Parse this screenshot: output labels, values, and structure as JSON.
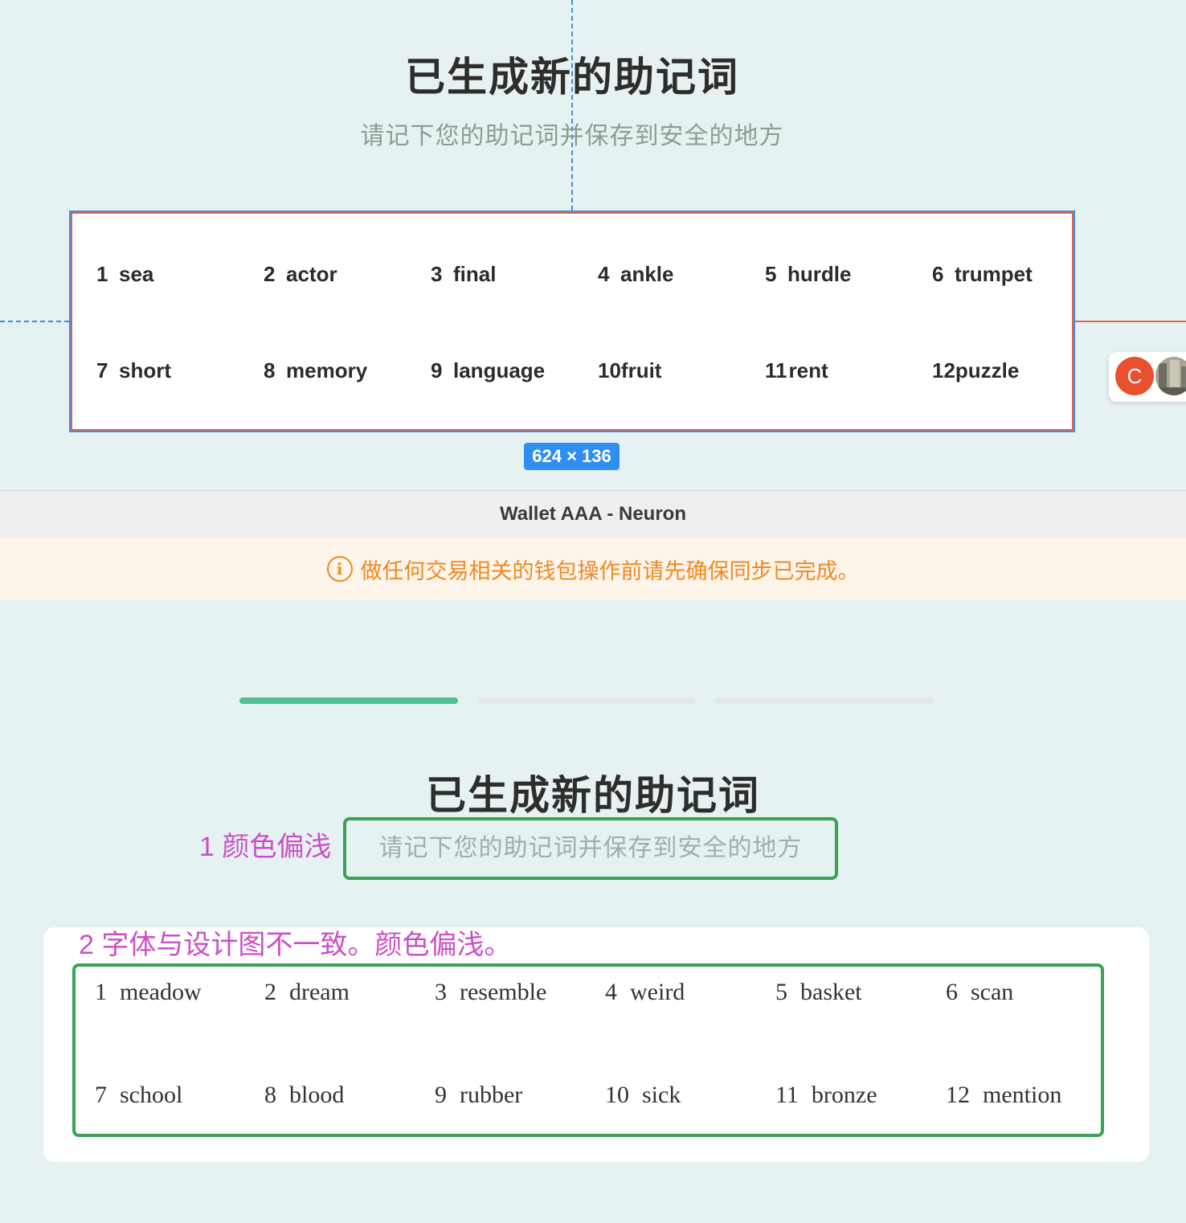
{
  "design": {
    "title": "已生成新的助记词",
    "subtitle": "请记下您的助记词并保存到安全的地方",
    "words": [
      {
        "num": "1",
        "word": "sea"
      },
      {
        "num": "2",
        "word": "actor"
      },
      {
        "num": "3",
        "word": "final"
      },
      {
        "num": "4",
        "word": "ankle"
      },
      {
        "num": "5",
        "word": "hurdle"
      },
      {
        "num": "6",
        "word": "trumpet"
      },
      {
        "num": "7",
        "word": "short"
      },
      {
        "num": "8",
        "word": "memory"
      },
      {
        "num": "9",
        "word": "language"
      },
      {
        "num": "10",
        "word": "fruit"
      },
      {
        "num": "11",
        "word": "rent"
      },
      {
        "num": "12",
        "word": "puzzle"
      }
    ],
    "size_badge": "624 × 136",
    "avatar_letter": "C"
  },
  "app": {
    "window_title": "Wallet AAA - Neuron",
    "warning": "做任何交易相关的钱包操作前请先确保同步已完成。",
    "warning_icon": "info-icon",
    "steps": [
      {
        "state": "active"
      },
      {
        "state": "inactive"
      },
      {
        "state": "inactive"
      }
    ],
    "title": "已生成新的助记词",
    "subtitle": "请记下您的助记词并保存到安全的地方",
    "words": [
      {
        "num": "1",
        "word": "meadow"
      },
      {
        "num": "2",
        "word": "dream"
      },
      {
        "num": "3",
        "word": "resemble"
      },
      {
        "num": "4",
        "word": "weird"
      },
      {
        "num": "5",
        "word": "basket"
      },
      {
        "num": "6",
        "word": "scan"
      },
      {
        "num": "7",
        "word": "school"
      },
      {
        "num": "8",
        "word": "blood"
      },
      {
        "num": "9",
        "word": "rubber"
      },
      {
        "num": "10",
        "word": "sick"
      },
      {
        "num": "11",
        "word": "bronze"
      },
      {
        "num": "12",
        "word": "mention"
      }
    ]
  },
  "annotations": {
    "note1": "1 颜色偏浅",
    "note2": "2 字体与设计图不一致。颜色偏浅。"
  },
  "colors": {
    "background": "#e6f2f1",
    "step_active": "#4dc193",
    "warning": "#f08a24",
    "annotation_text": "#cc4fc8",
    "annotation_box": "#3aa253",
    "selection_blue": "#3d8fe0",
    "selection_red": "#e0644a"
  }
}
